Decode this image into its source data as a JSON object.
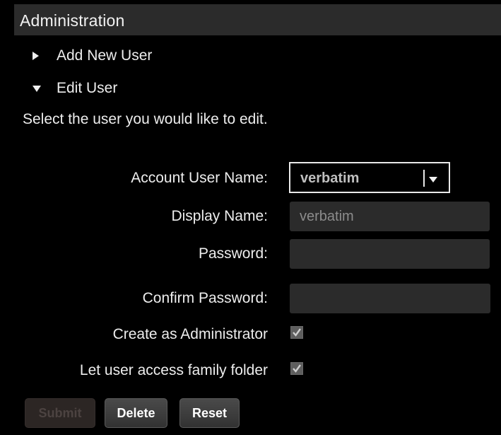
{
  "header": {
    "title": "Administration"
  },
  "sections": {
    "add_new_user": {
      "label": "Add New User",
      "icon": "triangle-right-icon"
    },
    "edit_user": {
      "label": "Edit User",
      "icon": "triangle-down-icon"
    }
  },
  "instructions": "Select the user you would like to edit.",
  "form": {
    "account_user_name": {
      "label": "Account User Name:",
      "selected": "verbatim",
      "icon": "dropdown-arrow-icon"
    },
    "display_name": {
      "label": "Display Name:",
      "value": "verbatim"
    },
    "password": {
      "label": "Password:",
      "value": ""
    },
    "confirm_password": {
      "label": "Confirm Password:",
      "value": ""
    },
    "create_admin": {
      "label": "Create as Administrator",
      "checked": true
    },
    "family_folder": {
      "label": "Let user access family folder",
      "checked": true
    }
  },
  "buttons": {
    "submit": "Submit",
    "delete": "Delete",
    "reset": "Reset"
  },
  "colors": {
    "background": "#000000",
    "header_bg": "#2b2b2b",
    "input_bg": "#2b2b2b",
    "text": "#ededed",
    "disabled_button_bg": "#2c2624"
  }
}
